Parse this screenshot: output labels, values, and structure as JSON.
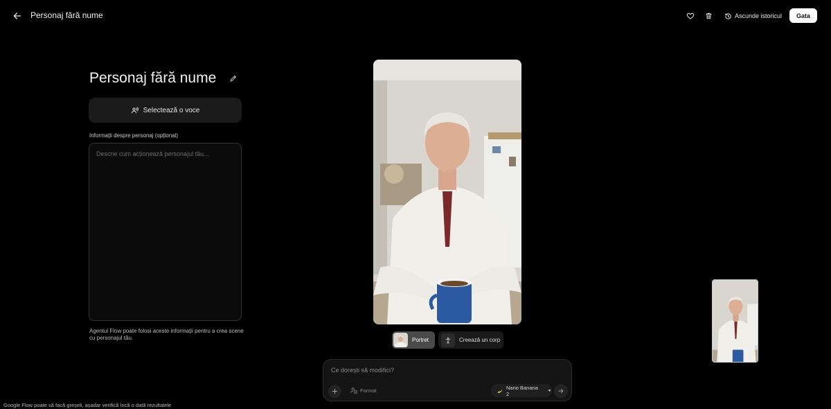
{
  "header": {
    "title": "Personaj fără nume",
    "hide_history_label": "Ascunde istoricul",
    "done_label": "Gata"
  },
  "character": {
    "name": "Personaj fără nume",
    "voice_button_label": "Selectează o voce",
    "info_label": "Informații despre personaj (opțional)",
    "description_placeholder": "Descrie cum acționează personajul tău...",
    "helper_text": "Agentul Flow poate folosi aceste informații pentru a crea scene cu personajul tău."
  },
  "views": {
    "portrait_label": "Portret",
    "create_body_label": "Creează un corp"
  },
  "prompt": {
    "placeholder": "Ce dorești să modifici?",
    "format_label": "Format",
    "model_label": "Nano Banana 2"
  },
  "footer": {
    "note": "Google Flow poate să facă greșeli, așadar verifică încă o dată rezultatele"
  },
  "icons": {
    "back": "arrow-left-icon",
    "favorite": "heart-icon",
    "delete": "trash-icon",
    "history": "history-icon",
    "edit": "pencil-icon",
    "voice": "voice-icon",
    "body": "person-icon",
    "add": "plus-icon",
    "format": "format-icon",
    "model": "banana-icon",
    "dropdown": "chevron-down-icon",
    "send": "arrow-right-icon"
  },
  "colors": {
    "background": "#000000",
    "panel": "#1b1b1b",
    "done_button": "#ffffff",
    "accent_model": "#f2c94c"
  }
}
